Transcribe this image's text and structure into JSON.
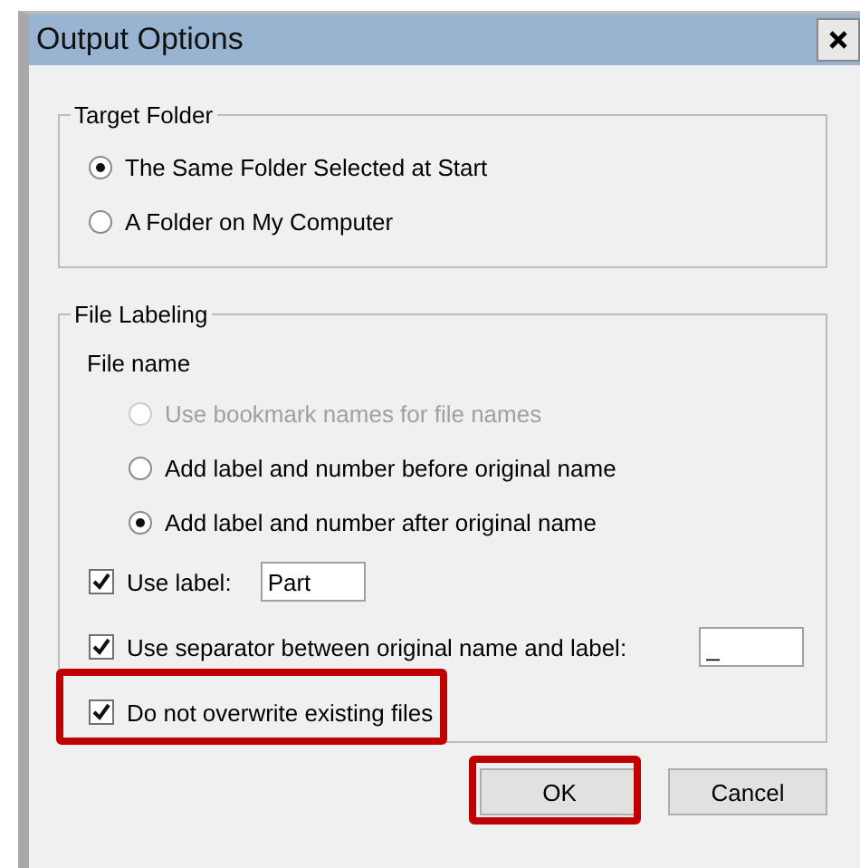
{
  "window": {
    "title": "Output Options"
  },
  "target_folder": {
    "title": "Target Folder",
    "options": [
      {
        "label": "The Same Folder Selected at Start",
        "selected": true
      },
      {
        "label": "A Folder on My Computer",
        "selected": false
      }
    ]
  },
  "file_labeling": {
    "title": "File Labeling",
    "subtitle": "File name",
    "options": [
      {
        "label": "Use bookmark names for file names",
        "selected": false,
        "disabled": true
      },
      {
        "label": "Add label and number before original name",
        "selected": false,
        "disabled": false
      },
      {
        "label": "Add label and number after original name",
        "selected": true,
        "disabled": false
      }
    ],
    "checkboxes": [
      {
        "kind": "short_field",
        "label": "Use label:",
        "checked": true,
        "value": "Part",
        "highlighted": false
      },
      {
        "kind": "far_field",
        "label": "Use separator between original name and label:",
        "checked": true,
        "value": "_",
        "highlighted": false
      },
      {
        "kind": "plain",
        "label": "Do not overwrite existing files",
        "checked": true,
        "highlighted": true
      }
    ]
  },
  "buttons": [
    {
      "label": "OK",
      "highlighted": true
    },
    {
      "label": "Cancel",
      "highlighted": false
    }
  ]
}
